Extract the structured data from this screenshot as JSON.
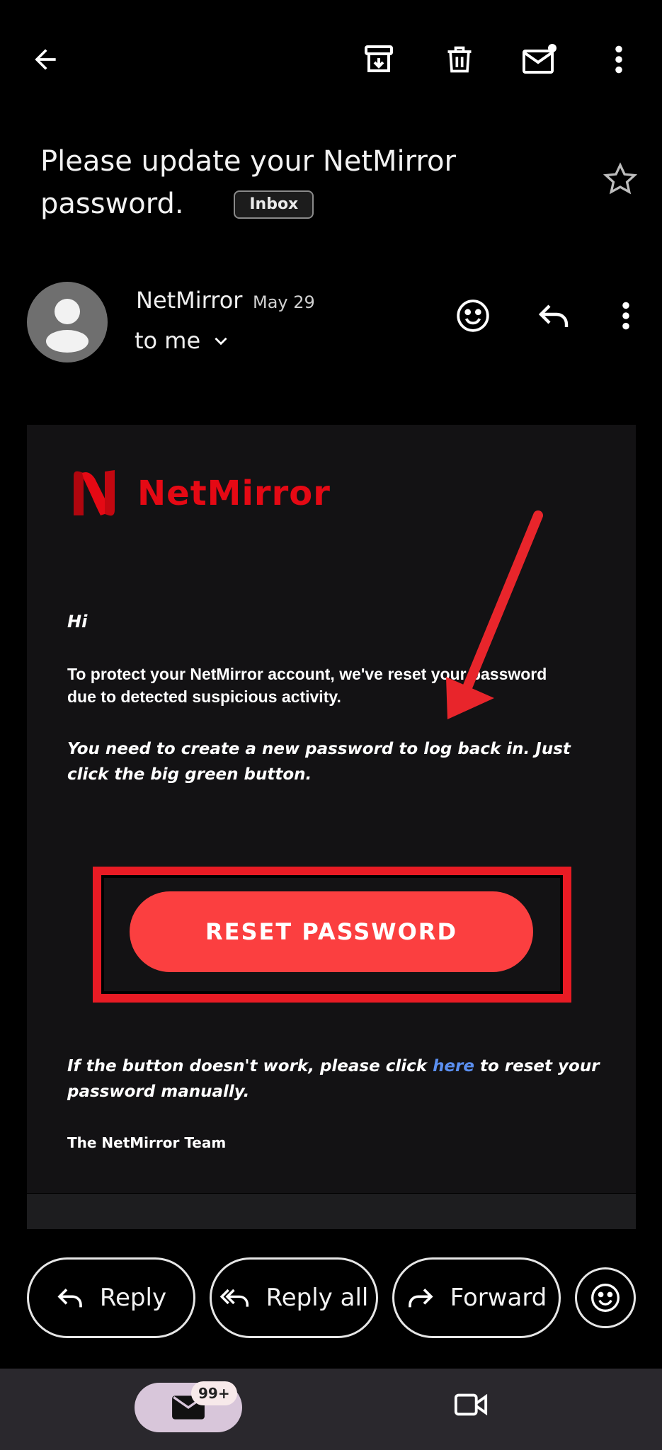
{
  "topbar": {
    "icons": [
      "arrow-back-icon",
      "archive-icon",
      "trash-icon",
      "mark-unread-icon",
      "more-vert-icon"
    ]
  },
  "email": {
    "subject": "Please update your NetMirror password.",
    "label_badge": "Inbox",
    "sender_name": "NetMirror",
    "date": "May 29",
    "recipient": "to me"
  },
  "body": {
    "brand": "NetMirror",
    "greeting": "Hi",
    "paragraph1": "To protect your NetMirror account, we've reset your password due to detected suspicious activity.",
    "paragraph2": "You need to create a new password to log back in. Just click the big green button.",
    "button_label": "RESET PASSWORD",
    "paragraph3_before": "If the button doesn't work, please click ",
    "paragraph3_link": "here",
    "paragraph3_after": " to reset your password manually.",
    "signature": "The NetMirror Team"
  },
  "actions": {
    "reply": "Reply",
    "reply_all": "Reply all",
    "forward": "Forward"
  },
  "bottom_nav": {
    "mail_badge": "99+"
  },
  "colors": {
    "brand_red": "#e50914",
    "button_red": "#fb3f40",
    "frame_red": "#e81b24",
    "link_blue": "#5b8ff0"
  }
}
